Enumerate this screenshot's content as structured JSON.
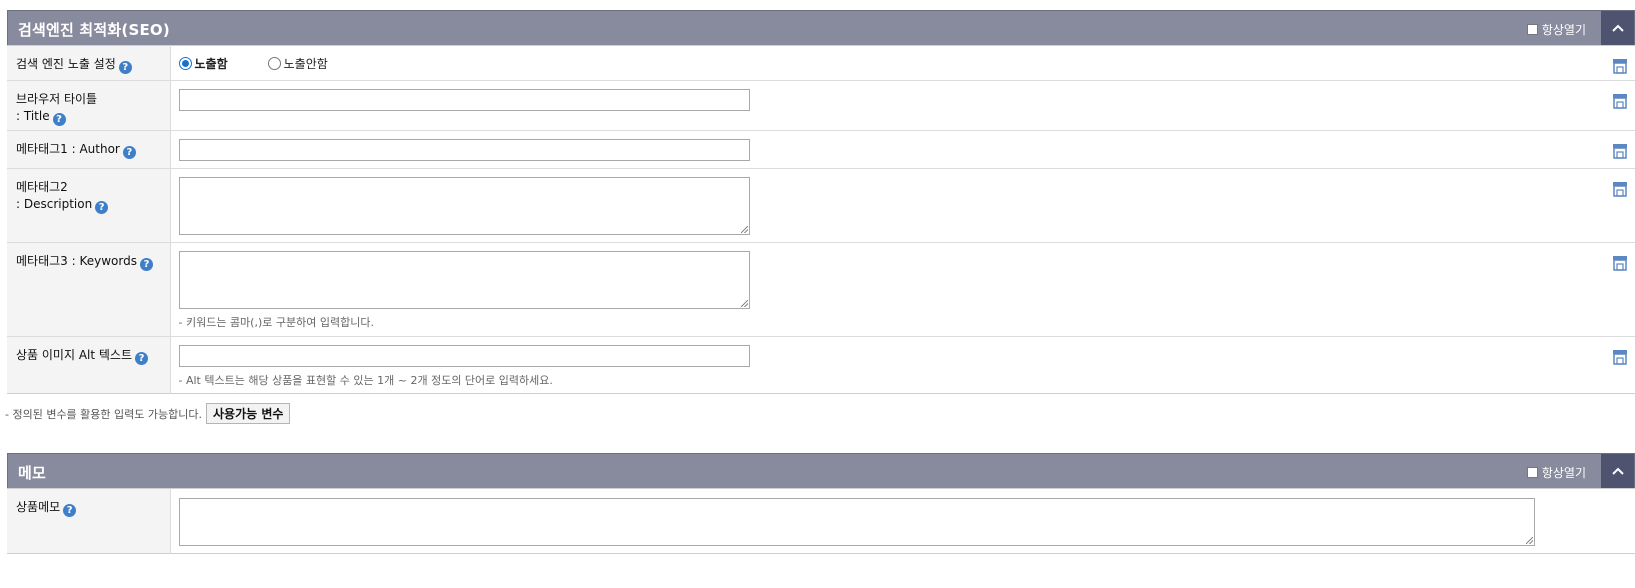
{
  "seo": {
    "title": "검색엔진 최적화(SEO)",
    "always_open": "항상열기",
    "rows": {
      "exposure": {
        "label": "검색 엔진 노출 설정",
        "option_on": "노출함",
        "option_off": "노출안함"
      },
      "title": {
        "label_line1": "브라우저 타이틀",
        "label_line2": ": Title"
      },
      "author": {
        "label": "메타태그1 : Author"
      },
      "description": {
        "label_line1": "메타태그2",
        "label_line2": ": Description"
      },
      "keywords": {
        "label": "메타태그3 : Keywords",
        "hint": "- 키워드는 콤마(,)로 구분하여 입력합니다."
      },
      "alt_text": {
        "label": "상품 이미지 Alt 텍스트",
        "hint": "- Alt 텍스트는 해당 상품을 표현할 수 있는 1개 ~ 2개 정도의 단어로 입력하세요."
      }
    },
    "footer_note": "- 정의된 변수를 활용한 입력도 가능합니다.",
    "variables_button": "사용가능 변수"
  },
  "memo": {
    "title": "메모",
    "always_open": "항상열기",
    "rows": {
      "product_memo": {
        "label": "상품메모"
      }
    }
  },
  "icons": {
    "help": "help-icon",
    "toggle": "chevron-up-icon",
    "store": "storefront-icon"
  },
  "help_glyph": "?",
  "colors": {
    "header_bg": "#888a9d",
    "toggle_bg": "#4e5470",
    "help": "#3f7fc7",
    "label_bg": "#f4f4f4"
  }
}
